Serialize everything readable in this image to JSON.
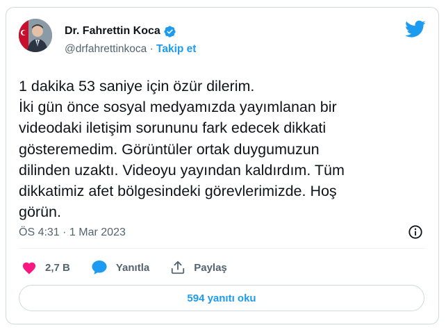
{
  "author": {
    "display_name": "Dr. Fahrettin Koca",
    "handle": "@drfahrettinkoca",
    "separator": " · ",
    "follow_label": "Takip et",
    "verified": true
  },
  "tweet": {
    "text": "1 dakika 53 saniye için özür dilerim.\nİki gün önce sosyal medyamızda yayımlanan bir\nvideodaki iletişim sorununu fark edecek dikkati\ngösteremedim. Görüntüler ortak duygumuzun\ndilinden uzaktı. Videoyu yayından kaldırdım. Tüm\ndikkatimiz afet bölgesindeki görevlerimizde. Hoş\ngörün.",
    "time": "ÖS 4:31",
    "date_separator": " · ",
    "date": "1 Mar 2023"
  },
  "actions": {
    "likes_count": "2,7 B",
    "reply_label": "Yanıtla",
    "share_label": "Paylaş"
  },
  "replies_button": "594 yanıtı oku",
  "colors": {
    "accent": "#1d9bf0",
    "like": "#f91880",
    "text": "#0f1419",
    "muted": "#536471",
    "border": "#cfd9de"
  },
  "icons": [
    "avatar-photo",
    "verified-badge-icon",
    "twitter-bird-icon",
    "info-icon",
    "heart-icon",
    "reply-icon",
    "share-icon"
  ]
}
